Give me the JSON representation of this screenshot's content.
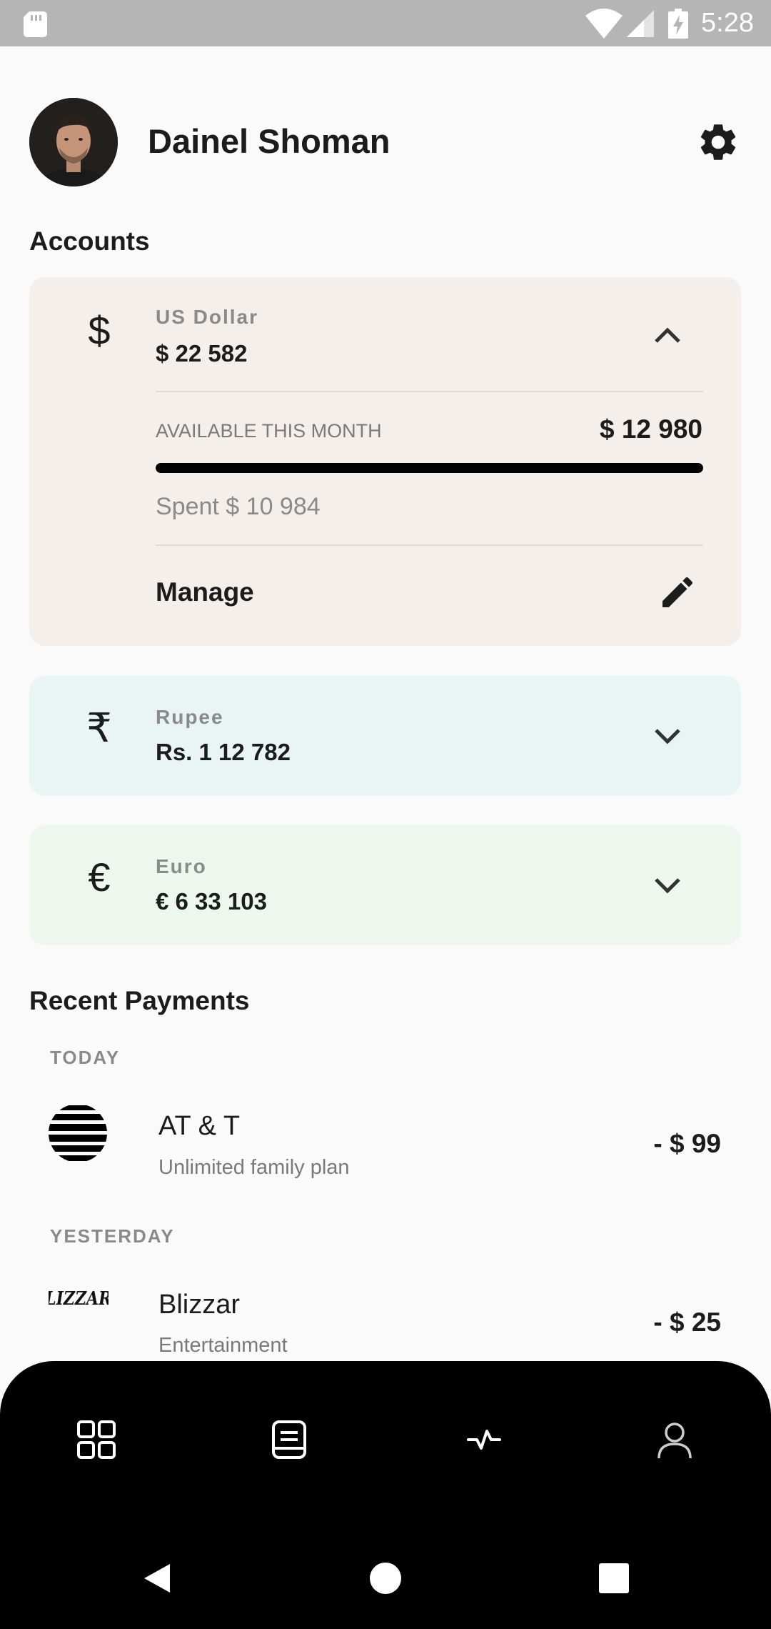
{
  "status_bar": {
    "time": "5:28",
    "icons": [
      "sd-card-icon",
      "wifi-icon",
      "signal-icon",
      "battery-charging-icon"
    ]
  },
  "profile": {
    "name": "Dainel Shoman",
    "avatar": "avatar",
    "settings_icon": "gear-icon"
  },
  "accounts": {
    "title": "Accounts",
    "items": [
      {
        "symbol": "$",
        "name": "US Dollar",
        "balance": "$ 22 582",
        "expanded": true,
        "background": "#f4efea",
        "available_label": "AVAILABLE THIS MONTH",
        "available_amount": "$ 12 980",
        "spent_text": "Spent $ 10 984",
        "spent_fraction": 1.0,
        "manage_label": "Manage"
      },
      {
        "symbol": "₹",
        "name": "Rupee",
        "balance": "Rs. 1 12 782",
        "expanded": false,
        "background": "#e9f4f4"
      },
      {
        "symbol": "€",
        "name": "Euro",
        "balance": "€ 6 33 103",
        "expanded": false,
        "background": "#edf7ed"
      }
    ]
  },
  "payments": {
    "title": "Recent Payments",
    "groups": [
      {
        "label": "TODAY",
        "items": [
          {
            "name": "AT & T",
            "description": "Unlimited family plan",
            "amount": "- $ 99",
            "logo": "att-logo"
          }
        ]
      },
      {
        "label": "YESTERDAY",
        "items": [
          {
            "name": "Blizzar",
            "description": "Entertainment",
            "amount": "- $ 25",
            "logo": "blizzard-logo",
            "logo_text": "BLIZZARD"
          }
        ]
      }
    ]
  },
  "bottom_nav": {
    "items": [
      "dashboard-icon",
      "statement-icon",
      "activity-icon",
      "profile-icon"
    ]
  },
  "system_nav": {
    "items": [
      "back-icon",
      "home-icon",
      "recents-icon"
    ]
  },
  "colors": {
    "accent": "#000000",
    "muted_text": "#8a8a8a",
    "usd_card": "#f4efea",
    "inr_card": "#e9f4f4",
    "eur_card": "#edf7ed"
  }
}
